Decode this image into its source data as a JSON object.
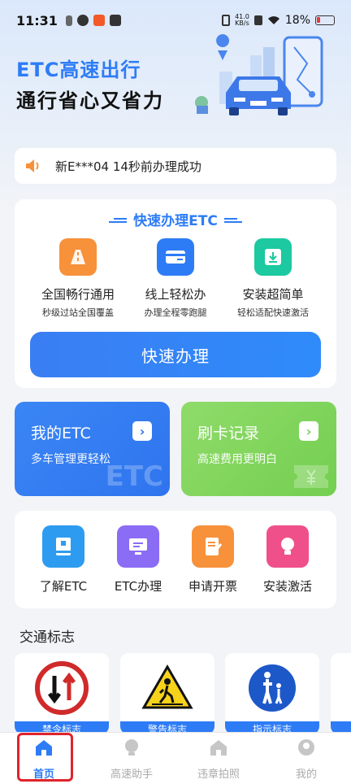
{
  "status": {
    "time": "11:31",
    "net_speed_top": "41.0",
    "net_speed_unit": "KB/s",
    "battery": "18%"
  },
  "hero": {
    "title": "ETC高速出行",
    "subtitle": "通行省心又省力"
  },
  "notice": {
    "text": "新E***04 14秒前办理成功"
  },
  "quick": {
    "title": "快速办理ETC",
    "features": [
      {
        "title": "全国畅行通用",
        "desc": "秒级过站全国覆盖",
        "color": "#f7913a",
        "icon": "road-icon"
      },
      {
        "title": "线上轻松办",
        "desc": "办理全程零跑腿",
        "color": "#2d7cf6",
        "icon": "card-icon"
      },
      {
        "title": "安装超简单",
        "desc": "轻松适配快速激活",
        "color": "#1cc9a0",
        "icon": "install-icon"
      }
    ],
    "button": "快速办理"
  },
  "cards": {
    "my_etc": {
      "title": "我的ETC",
      "desc": "多车管理更轻松",
      "watermark": "ETC"
    },
    "records": {
      "title": "刷卡记录",
      "desc": "高速费用更明白"
    }
  },
  "services": [
    {
      "label": "了解ETC",
      "color": "#2d9cf0",
      "icon": "book-icon"
    },
    {
      "label": "ETC办理",
      "color": "#8b6cf5",
      "icon": "monitor-icon"
    },
    {
      "label": "申请开票",
      "color": "#f7913a",
      "icon": "invoice-icon"
    },
    {
      "label": "安装激活",
      "color": "#f0508a",
      "icon": "bulb-icon"
    }
  ],
  "traffic": {
    "title": "交通标志",
    "signs": [
      {
        "label": "禁令标志",
        "icon": "no-overtaking-sign-icon"
      },
      {
        "label": "警告标志",
        "icon": "pedestrian-warning-sign-icon"
      },
      {
        "label": "指示标志",
        "icon": "walk-zone-sign-icon"
      }
    ]
  },
  "tabs": [
    {
      "label": "首页",
      "icon": "home-icon",
      "active": true
    },
    {
      "label": "高速助手",
      "icon": "assistant-icon",
      "active": false
    },
    {
      "label": "违章拍照",
      "icon": "camera-icon",
      "active": false
    },
    {
      "label": "我的",
      "icon": "profile-icon",
      "active": false
    }
  ],
  "colors": {
    "accent": "#2d7cf6",
    "highlight": "#e0232b",
    "card_green": "#7fd45c"
  }
}
